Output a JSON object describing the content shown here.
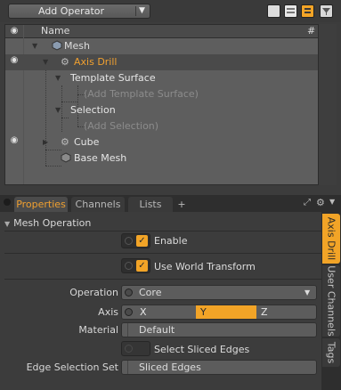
{
  "toolbar": {
    "add_operator_label": "Add Operator"
  },
  "tree": {
    "header": {
      "name": "Name",
      "hash": "#"
    },
    "items": [
      {
        "label": "Mesh"
      },
      {
        "label": "Axis Drill"
      },
      {
        "label": "Template Surface"
      },
      {
        "label": "(Add Template Surface)"
      },
      {
        "label": "Selection"
      },
      {
        "label": "(Add Selection)"
      },
      {
        "label": "Cube"
      },
      {
        "label": "Base Mesh"
      }
    ]
  },
  "tabs": [
    {
      "label": "Properties"
    },
    {
      "label": "Channels"
    },
    {
      "label": "Lists"
    },
    {
      "label": "+"
    }
  ],
  "properties": {
    "section": "Mesh Operation",
    "enable": {
      "label": "Enable",
      "checked": true
    },
    "world_transform": {
      "label": "Use World Transform",
      "checked": true
    },
    "operation": {
      "label": "Operation",
      "value": "Core"
    },
    "axis": {
      "label": "Axis",
      "options": [
        "X",
        "Y",
        "Z"
      ],
      "selected": "Y"
    },
    "material": {
      "label": "Material",
      "value": "Default"
    },
    "select_sliced_edges": {
      "label": "Select Sliced Edges",
      "checked": false
    },
    "edge_selection_set": {
      "label": "Edge Selection Set",
      "value": "Sliced Edges"
    }
  },
  "side_tabs": [
    {
      "label": "Axis Drill"
    },
    {
      "label": "User Channels"
    },
    {
      "label": "Tags"
    }
  ],
  "colors": {
    "accent": "#f2a427",
    "selected_text": "#f0a030"
  }
}
